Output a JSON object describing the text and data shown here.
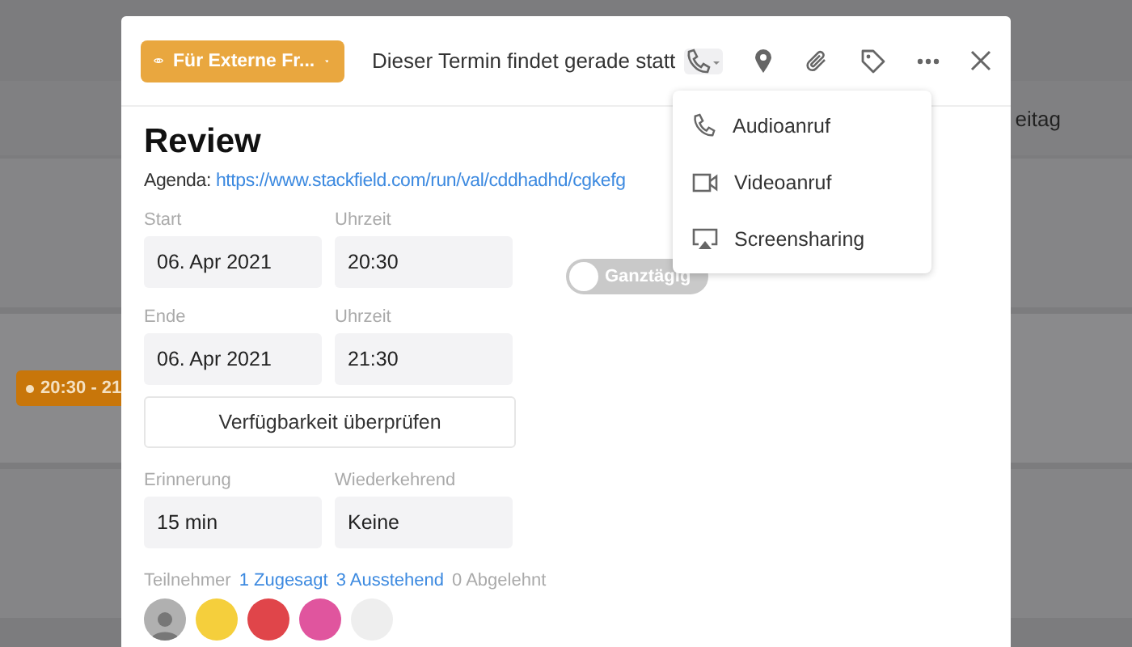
{
  "calendar": {
    "day_header": "eitag",
    "event": {
      "time": "20:30 - 21",
      "color": "#c8760a"
    }
  },
  "dialog": {
    "visibility_button": {
      "label": "Für Externe Fr..."
    },
    "status": "Dieser Termin findet gerade statt",
    "call_menu": {
      "expanded": true,
      "items": [
        {
          "kind": "audio",
          "label": "Audioanruf"
        },
        {
          "kind": "video",
          "label": "Videoanruf"
        },
        {
          "kind": "screen",
          "label": "Screensharing"
        }
      ]
    },
    "title": "Review",
    "agenda_label": "Agenda:",
    "agenda_link": "https://www.stackfield.com/run/val/cddhadhd/cgkefg",
    "all_day": {
      "label": "Ganztägig",
      "on": false
    },
    "fields": [
      {
        "label": "Start",
        "value": "06. Apr 2021"
      },
      {
        "label": "Uhrzeit",
        "value": "20:30"
      },
      {
        "label": "Ende",
        "value": "06. Apr 2021"
      },
      {
        "label": "Uhrzeit",
        "value": "21:30"
      }
    ],
    "check_button": "Verfügbarkeit überprüfen",
    "fields2": [
      {
        "label": "Erinnerung",
        "value": "15 min"
      },
      {
        "label": "Wiederkehrend",
        "value": "Keine"
      }
    ],
    "participants": {
      "label": "Teilnehmer",
      "accepted": "1 Zugesagt",
      "pending": "3 Ausstehend",
      "declined": "0 Abgelehnt",
      "avatars": [
        {
          "kind": "photo",
          "color": "#b0b0b0"
        },
        {
          "kind": "color",
          "color": "#f5cf3c"
        },
        {
          "kind": "color",
          "color": "#e0454a"
        },
        {
          "kind": "color",
          "color": "#e0559e"
        },
        {
          "kind": "color",
          "color": "#eeeeee"
        }
      ]
    }
  }
}
